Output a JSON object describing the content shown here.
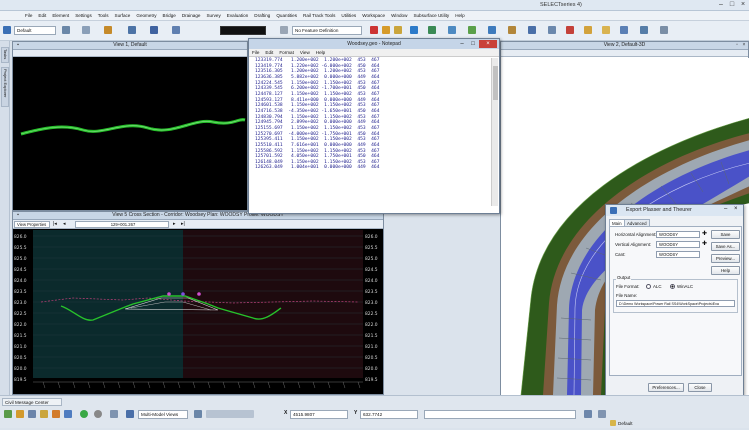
{
  "window": {
    "title": "SELECTseries 4)",
    "controls": [
      "–",
      "□",
      "×"
    ]
  },
  "menu": [
    "File",
    "Edit",
    "Element",
    "Settings",
    "Tools",
    "Surface",
    "Geometry",
    "Bridge",
    "Drainage",
    "Survey",
    "Evaluation",
    "Drafting",
    "Quantities",
    "Rail Track Tools",
    "Utilities",
    "Workspace",
    "Window",
    "Subsurface Utility",
    "Help"
  ],
  "toolbar": {
    "attribute_combo": "Default",
    "feature_combo": "No Feature Definition"
  },
  "left_tabs": [
    "Tasks",
    "Project Explorer"
  ],
  "view1": {
    "title": "View 1, Default"
  },
  "view2": {
    "title": "View 2, Default-3D"
  },
  "view5": {
    "title": "View 5 Cross Section - Corridor: Woodsey Plan: WOODSY Profile: WOODSY",
    "properties_combo": "View Properties",
    "station_combo": "129+001.267",
    "y_labels": [
      "826.0",
      "825.5",
      "825.0",
      "824.5",
      "824.0",
      "823.5",
      "823.0",
      "822.5",
      "822.0",
      "821.5",
      "821.0",
      "820.5",
      "820.0",
      "819.5"
    ]
  },
  "notepad": {
    "title": "Woodsey.geo - Notepad",
    "menu": [
      "File",
      "Edit",
      "Format",
      "View",
      "Help"
    ],
    "lines": [
      "123319.774   1.200e+002  1.200e+002  453  467",
      "123419.774   1.220e+002 -6.000e+002  450  464",
      "123516.305   1.200e+002  1.200e+002  453  467",
      "123636.385   5.882e+002  0.000e+000  449  464",
      "124224.545   1.150e+002  1.150e+002  453  467",
      "124339.545   6.200e+002 -1.700e+001  450  464",
      "124478.127   1.150e+002  1.150e+002  453  467",
      "124593.127   8.411e+000  0.000e+000  449  464",
      "124601.538   1.150e+002  1.150e+002  453  467",
      "124716.538  -4.350e+002 -1.650e+001  450  464",
      "124830.794   1.150e+002  1.150e+002  453  467",
      "124945.794   2.899e+002  0.000e+000  449  464",
      "125155.697   1.150e+002  1.150e+002  453  467",
      "125270.697  -4.000e+002 -1.750e+001  450  464",
      "125395.411   1.150e+002  1.150e+002  453  467",
      "125510.411   7.616e+001  0.000e+000  449  464",
      "125586.592   1.150e+002  1.150e+002  453  467",
      "125701.592   4.050e+002  1.750e+001  450  464",
      "126148.049   1.150e+002  1.150e+002  453  467",
      "126263.049   1.004e+001  0.000e+000  449  464"
    ]
  },
  "dialog": {
    "title": "Export Plasser and Theurer",
    "tabs": [
      "Main",
      "Advanced"
    ],
    "horizontal_label": "Horizontal Alignment:",
    "horizontal_value": "WOODSY",
    "vertical_label": "Vertical Alignment:",
    "vertical_value": "WOODSY",
    "cant_label": "Cant:",
    "cant_value": "WOODSY",
    "save": "Save",
    "save_as": "Save As...",
    "preview": "Preview...",
    "help": "Help",
    "output_label": "Output",
    "file_format_label": "File Format:",
    "format_alc": "ALC",
    "format_wincalc": "WinALC",
    "file_name_label": "File Name:",
    "file_name": "D:\\Demo Workspace\\Power Rail SS4\\WorkSpace\\Projects\\Exa",
    "preferences": "Preferences...",
    "close": "Close"
  },
  "status": {
    "message_center": "Civil Message Center",
    "view_mode": "Multi-Model Views",
    "x_label": "X",
    "x_value": "4515.9807",
    "y_label": "Y",
    "y_value": "632.7742",
    "level": "Default"
  },
  "colors": {
    "terrain": "#2e5a1b",
    "profile_line": "#27c22b",
    "design_band": "#7c5a3b",
    "track_blue": "#4a52c8"
  }
}
